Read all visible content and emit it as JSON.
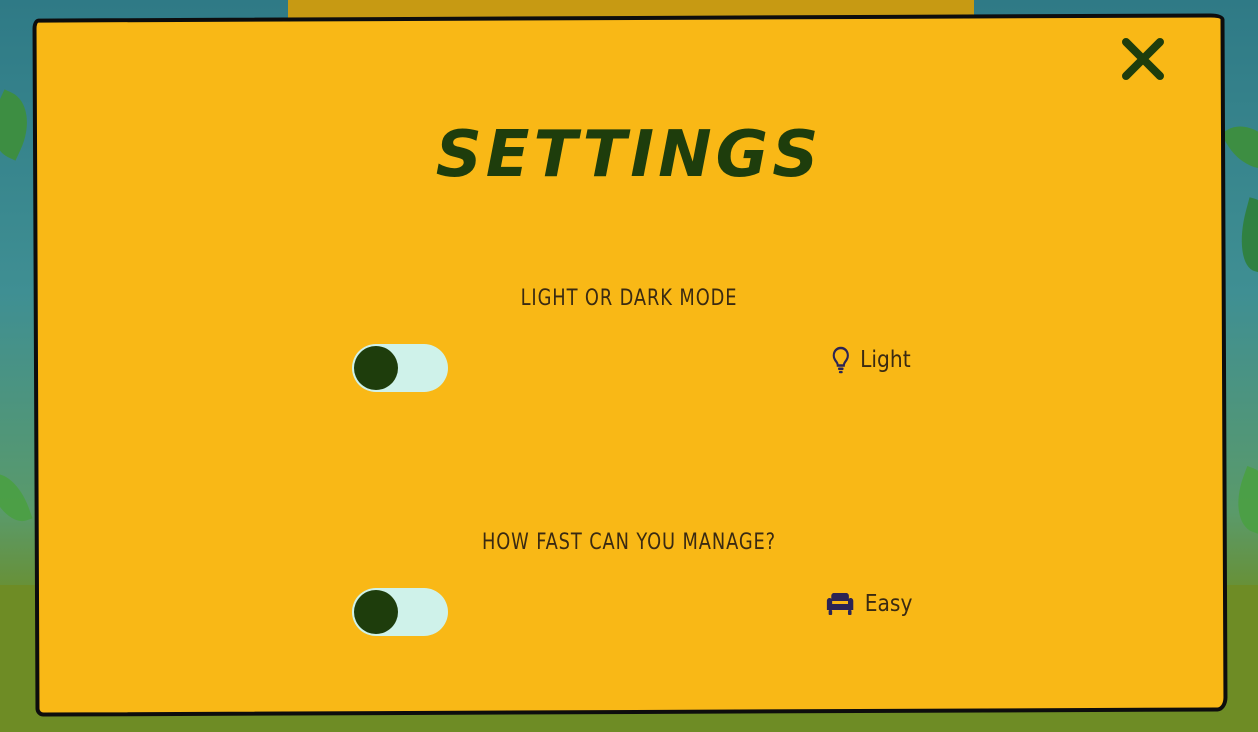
{
  "modal": {
    "title": "SETTINGS",
    "close_icon": "close-icon"
  },
  "settings": [
    {
      "label": "LIGHT OR DARK MODE",
      "toggle_on": false,
      "state_icon": "lightbulb-icon",
      "state_text": "Light"
    },
    {
      "label": "HOW FAST CAN YOU MANAGE?",
      "toggle_on": false,
      "state_icon": "couch-icon",
      "state_text": "Easy"
    }
  ],
  "colors": {
    "modal_background": "#f9b816",
    "title": "#1e3d0c",
    "toggle_track": "#cff2ea",
    "toggle_knob": "#1e3d0c",
    "couch_icon": "#2c2454"
  }
}
